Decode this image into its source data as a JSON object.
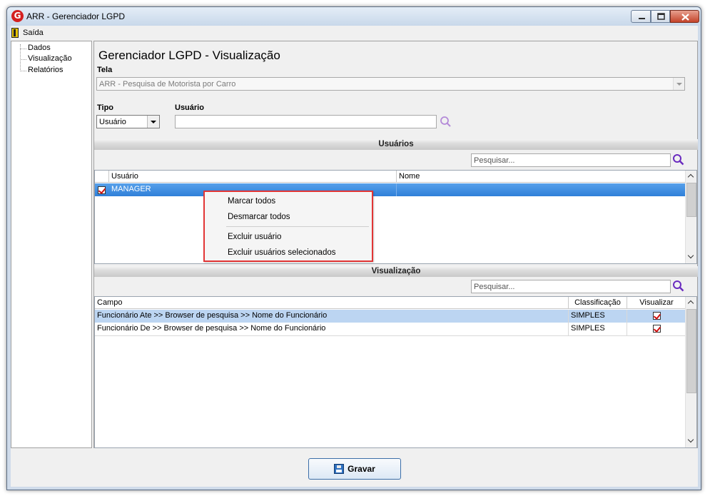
{
  "window": {
    "title": "ARR - Gerenciador LGPD",
    "app_logo": "G"
  },
  "menu": {
    "exit_label": "Saída"
  },
  "sidebar": {
    "items": [
      {
        "label": "Dados"
      },
      {
        "label": "Visualização"
      },
      {
        "label": "Relatórios"
      }
    ]
  },
  "page": {
    "title": "Gerenciador LGPD - Visualização"
  },
  "form": {
    "tela_label": "Tela",
    "tela_value": "ARR - Pesquisa de Motorista por Carro",
    "tipo_label": "Tipo",
    "tipo_value": "Usuário",
    "usuario_label": "Usuário",
    "usuario_value": ""
  },
  "usuarios": {
    "section_title": "Usuários",
    "search_placeholder": "Pesquisar...",
    "columns": [
      "Usuário",
      "Nome"
    ],
    "rows": [
      {
        "checked": true,
        "usuario": "MANAGER",
        "nome": ""
      }
    ]
  },
  "context_menu": {
    "items": [
      "Marcar todos",
      "Desmarcar todos",
      "Excluir usuário",
      "Excluir usuários selecionados"
    ]
  },
  "visualizacao": {
    "section_title": "Visualização",
    "search_placeholder": "Pesquisar...",
    "columns": [
      "Campo",
      "Classificação",
      "Visualizar"
    ],
    "rows": [
      {
        "campo": "Funcionário Ate >> Browser de pesquisa >> Nome do Funcionário",
        "classificacao": "SIMPLES",
        "visualizar": true
      },
      {
        "campo": "Funcionário De >> Browser de pesquisa >> Nome do Funcionário",
        "classificacao": "SIMPLES",
        "visualizar": true
      }
    ]
  },
  "footer": {
    "save_label": "Gravar"
  },
  "colors": {
    "selection": "#3a8ae0",
    "highlight": "#bcd5f2",
    "context_border": "#e23636",
    "search_icon": "#6a2bbf"
  }
}
